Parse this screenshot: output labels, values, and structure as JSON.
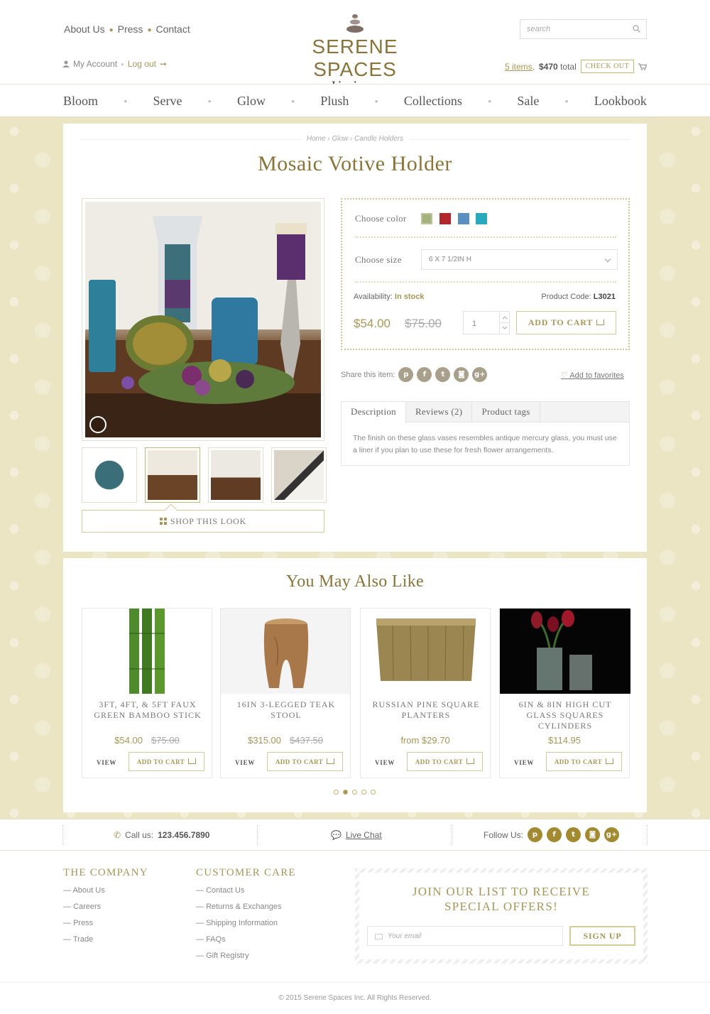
{
  "header": {
    "top_links": [
      "About Us",
      "Press",
      "Contact"
    ],
    "account_label": "My Account",
    "logout_label": "Log out",
    "logo_brand": "SERENE SPACES",
    "logo_sub": "living",
    "search_placeholder": "search",
    "cart_items": "5 items,",
    "cart_total": "$470",
    "cart_total_suffix": "total",
    "checkout_label": "CHECK OUT"
  },
  "nav": [
    "Bloom",
    "Serve",
    "Glow",
    "Plush",
    "Collections",
    "Sale",
    "Lookbook"
  ],
  "breadcrumb": [
    "Home",
    "Glow",
    "Candle Holders"
  ],
  "product": {
    "title": "Mosaic Votive Holder",
    "shop_look_label": "SHOP THIS LOOK",
    "choose_color_label": "Choose color",
    "colors": [
      "#a3b27a",
      "#b3262b",
      "#5a8fc0",
      "#2aa8be"
    ],
    "choose_size_label": "Choose size",
    "size_value": "6 X 7 1/2IN H",
    "availability_label": "Availability:",
    "availability_value": "In stock",
    "code_label": "Product Code:",
    "code_value": "L3021",
    "price": "$54.00",
    "old_price": "$75.00",
    "quantity": "1",
    "add_to_cart": "ADD TO CART",
    "share_label": "Share this item:",
    "add_favorites": "Add to favorites",
    "tabs": [
      "Description",
      "Reviews (2)",
      "Product tags"
    ],
    "description": "The finish on these glass vases resembles antique mercury glass, you must use a liner if you plan to use these for fresh flower arrangements."
  },
  "related": {
    "title": "You May Also Like",
    "view_label": "VIEW",
    "add_label": "ADD TO CART",
    "items": [
      {
        "name": "3FT, 4FT, & 5FT FAUX GREEN BAMBOO STICK",
        "price": "$54.00",
        "old_price": "$75.00"
      },
      {
        "name": "16IN 3-LEGGED TEAK STOOL",
        "price": "$315.00",
        "old_price": "$437.50"
      },
      {
        "name": "RUSSIAN PINE SQUARE PLANTERS",
        "price": "from $29.70",
        "old_price": ""
      },
      {
        "name": "6IN & 8IN HIGH CUT GLASS SQUARES CYLINDERS",
        "price": "$114.95",
        "old_price": ""
      }
    ]
  },
  "footer_bar": {
    "call_label": "Call us:",
    "phone": "123.456.7890",
    "live_chat": "Live Chat",
    "follow_label": "Follow Us:"
  },
  "footer": {
    "company_title": "THE COMPANY",
    "company_links": [
      "About Us",
      "Careers",
      "Press",
      "Trade"
    ],
    "care_title": "CUSTOMER CARE",
    "care_links": [
      "Contact Us",
      "Returns & Exchanges",
      "Shipping Information",
      "FAQs",
      "Gift Registry"
    ],
    "newsletter_line1": "JOIN OUR LIST TO RECEIVE",
    "newsletter_line2": "SPECIAL OFFERS!",
    "email_placeholder": "Your email",
    "signup_label": "SIGN UP",
    "copyright": "© 2015 Serene Spaces Inc. All Rights Reserved."
  }
}
